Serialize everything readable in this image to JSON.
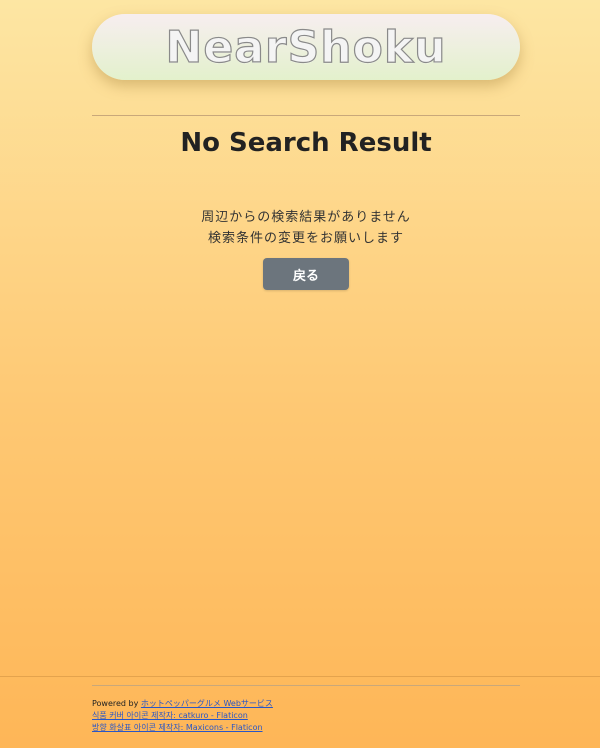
{
  "header": {
    "logo_text": "NearShoku"
  },
  "main": {
    "title": "No Search Result",
    "message_line1": "周辺からの検索結果がありません",
    "message_line2": "検索条件の変更をお願いします",
    "back_label": "戻る"
  },
  "footer": {
    "powered_by_label": "Powered by",
    "powered_by_link": "ホットペッパーグルメ Webサービス",
    "credit1": "식품 커버 아이콘 제작자: catkuro - Flaticon",
    "credit2": "방향 화살표 아이콘 제작자: Maxicons - Flaticon"
  },
  "colors": {
    "button": "#6c757d",
    "link": "#2a56c6",
    "background_top": "#fde6a3",
    "background_bottom": "#feb657"
  }
}
